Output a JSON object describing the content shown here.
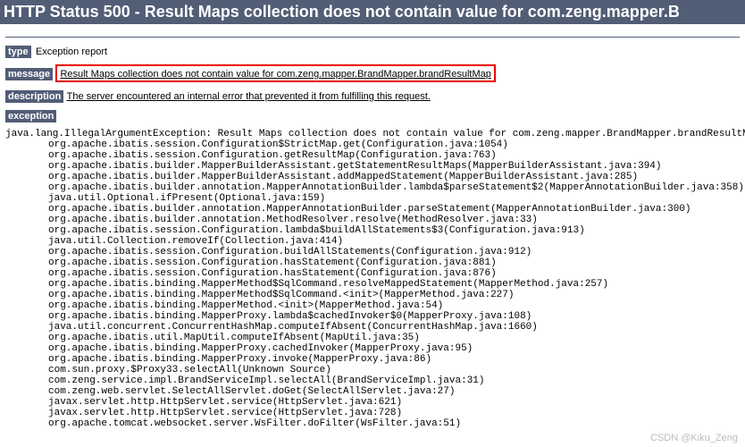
{
  "header": {
    "title": "HTTP Status 500 - Result Maps collection does not contain value for com.zeng.mapper.B"
  },
  "labels": {
    "type": "type",
    "message": "message",
    "description": "description",
    "exception": "exception"
  },
  "type_text": "Exception report",
  "message_text": "Result Maps collection does not contain value for com.zeng.mapper.BrandMapper.brandResultMap",
  "description_text": "The server encountered an internal error that prevented it from fulfilling this request.",
  "exception_first": "java.lang.IllegalArgumentException: Result Maps collection does not contain value for com.zeng.mapper.BrandMapper.brandResultMap",
  "stack": [
    "org.apache.ibatis.session.Configuration$StrictMap.get(Configuration.java:1054)",
    "org.apache.ibatis.session.Configuration.getResultMap(Configuration.java:763)",
    "org.apache.ibatis.builder.MapperBuilderAssistant.getStatementResultMaps(MapperBuilderAssistant.java:394)",
    "org.apache.ibatis.builder.MapperBuilderAssistant.addMappedStatement(MapperBuilderAssistant.java:285)",
    "org.apache.ibatis.builder.annotation.MapperAnnotationBuilder.lambda$parseStatement$2(MapperAnnotationBuilder.java:358)",
    "java.util.Optional.ifPresent(Optional.java:159)",
    "org.apache.ibatis.builder.annotation.MapperAnnotationBuilder.parseStatement(MapperAnnotationBuilder.java:300)",
    "org.apache.ibatis.builder.annotation.MethodResolver.resolve(MethodResolver.java:33)",
    "org.apache.ibatis.session.Configuration.lambda$buildAllStatements$3(Configuration.java:913)",
    "java.util.Collection.removeIf(Collection.java:414)",
    "org.apache.ibatis.session.Configuration.buildAllStatements(Configuration.java:912)",
    "org.apache.ibatis.session.Configuration.hasStatement(Configuration.java:881)",
    "org.apache.ibatis.session.Configuration.hasStatement(Configuration.java:876)",
    "org.apache.ibatis.binding.MapperMethod$SqlCommand.resolveMappedStatement(MapperMethod.java:257)",
    "org.apache.ibatis.binding.MapperMethod$SqlCommand.<init>(MapperMethod.java:227)",
    "org.apache.ibatis.binding.MapperMethod.<init>(MapperMethod.java:54)",
    "org.apache.ibatis.binding.MapperProxy.lambda$cachedInvoker$0(MapperProxy.java:108)",
    "java.util.concurrent.ConcurrentHashMap.computeIfAbsent(ConcurrentHashMap.java:1660)",
    "org.apache.ibatis.util.MapUtil.computeIfAbsent(MapUtil.java:35)",
    "org.apache.ibatis.binding.MapperProxy.cachedInvoker(MapperProxy.java:95)",
    "org.apache.ibatis.binding.MapperProxy.invoke(MapperProxy.java:86)",
    "com.sun.proxy.$Proxy33.selectAll(Unknown Source)",
    "com.zeng.service.impl.BrandServiceImpl.selectAll(BrandServiceImpl.java:31)",
    "com.zeng.web.servlet.SelectAllServlet.doGet(SelectAllServlet.java:27)",
    "javax.servlet.http.HttpServlet.service(HttpServlet.java:621)",
    "javax.servlet.http.HttpServlet.service(HttpServlet.java:728)",
    "org.apache.tomcat.websocket.server.WsFilter.doFilter(WsFilter.java:51)"
  ],
  "watermark": "CSDN @Kiku_Zeng"
}
